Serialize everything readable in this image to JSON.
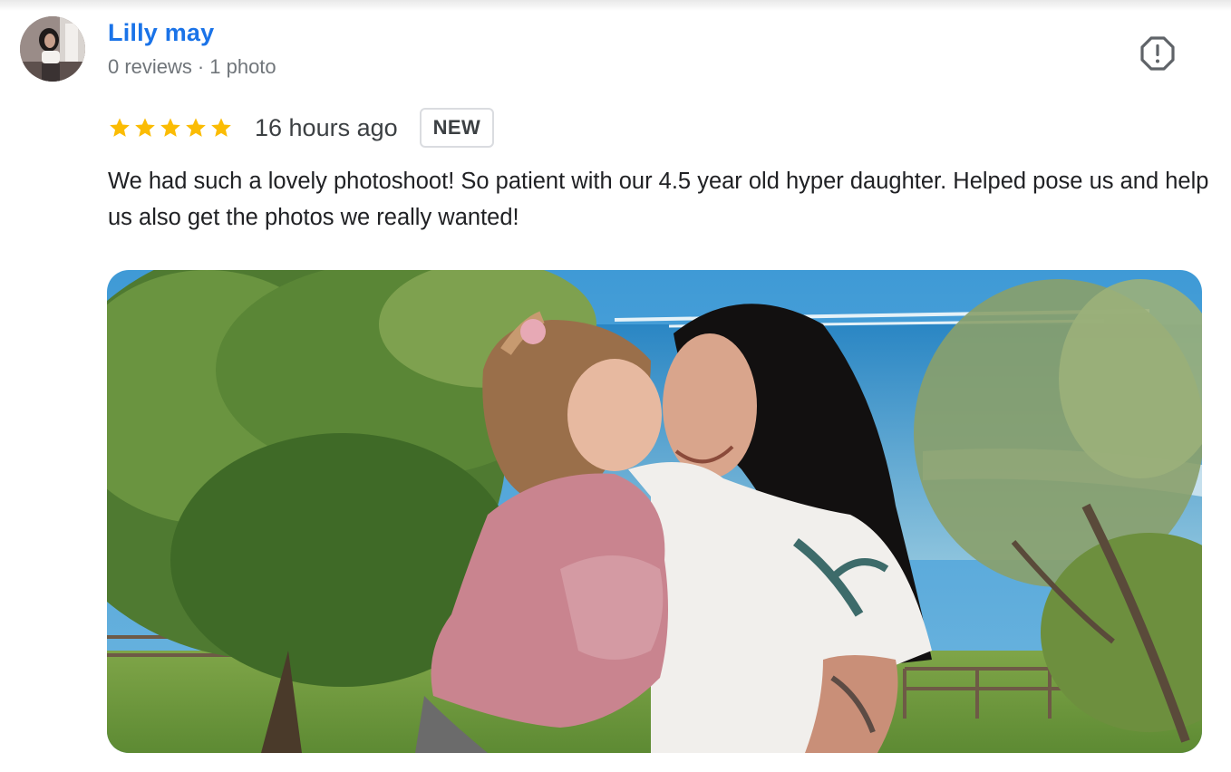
{
  "reviewer": {
    "name": "Lilly may",
    "reviews_count": "0 reviews",
    "separator": "·",
    "photos_count": "1 photo"
  },
  "review": {
    "rating": 5,
    "max_rating": 5,
    "time_ago": "16 hours ago",
    "badge": "NEW",
    "text": "We had such a lovely photoshoot! So patient with our 4.5 year old hyper daughter. Helped pose us and help us also get the photos we really wanted!"
  },
  "icons": {
    "report": "report-flag-icon",
    "star": "star-icon"
  },
  "colors": {
    "name_link": "#1a73e8",
    "star": "#fbbc04",
    "meta_text": "#70757a",
    "body_text": "#202124",
    "badge_border": "#dadce0"
  }
}
